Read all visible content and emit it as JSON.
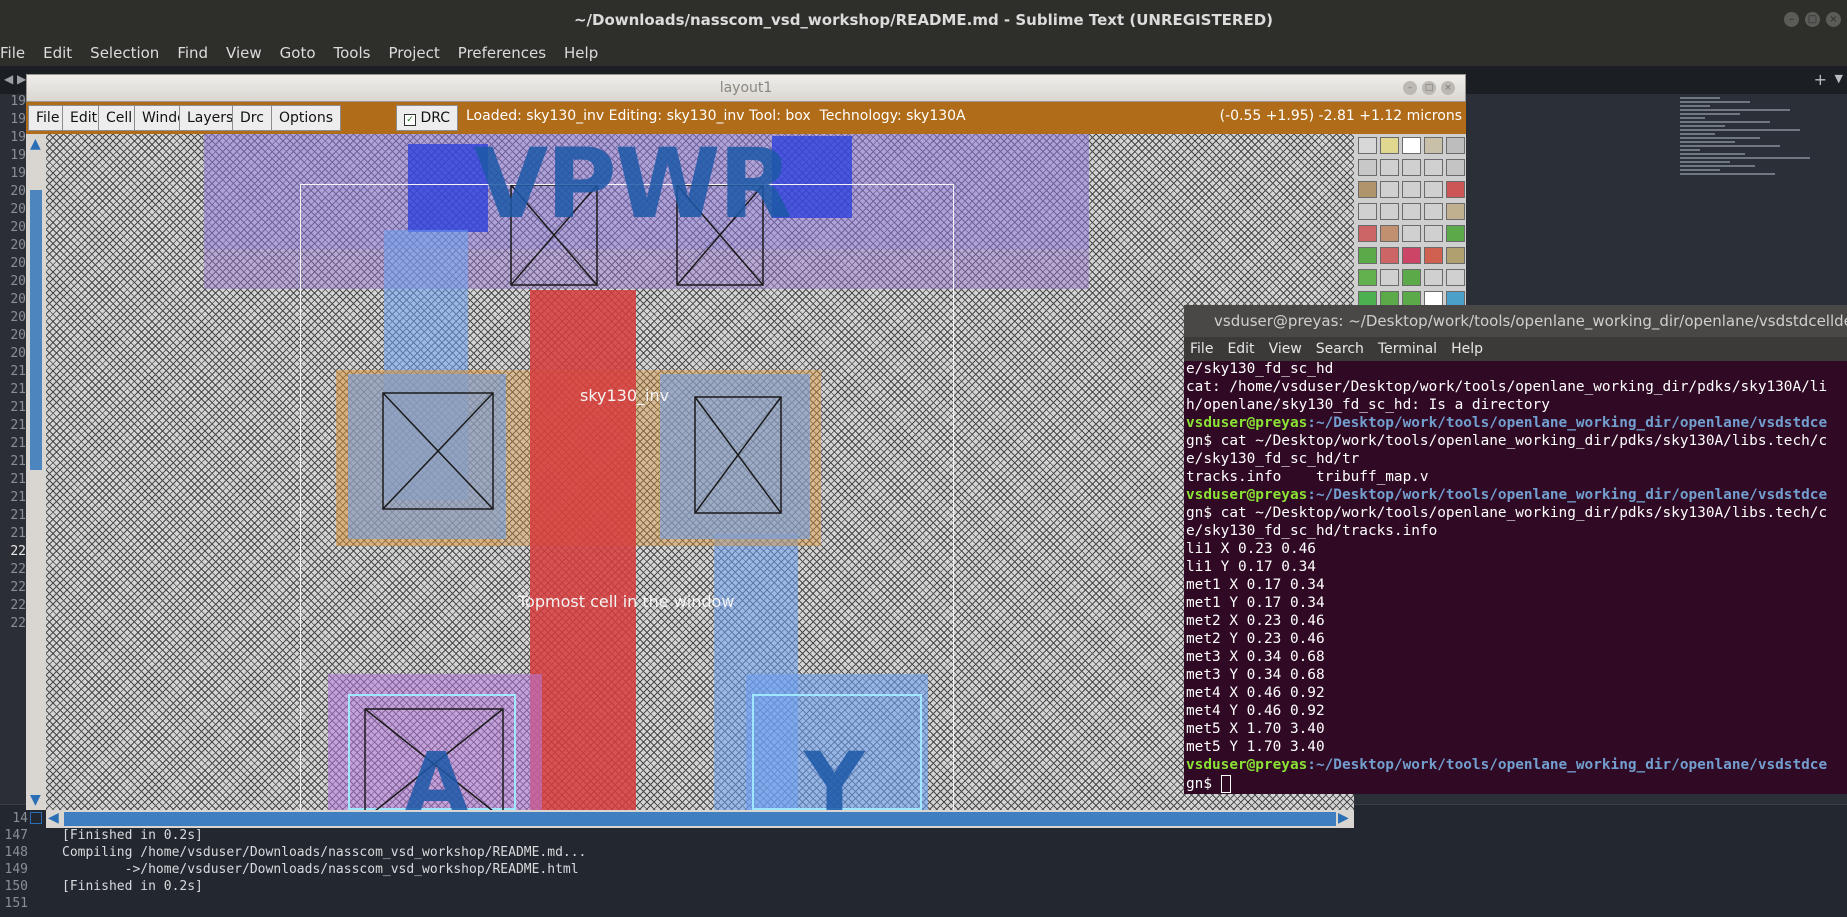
{
  "sublime": {
    "title": "~/Downloads/nasscom_vsd_workshop/README.md - Sublime Text (UNREGISTERED)",
    "menu": [
      "File",
      "Edit",
      "Selection",
      "Find",
      "View",
      "Goto",
      "Tools",
      "Project",
      "Preferences",
      "Help"
    ],
    "gutter_numbers": [
      "19",
      "19",
      "19",
      "19",
      "19",
      "20",
      "20",
      "20",
      "20",
      "20",
      "20",
      "20",
      "20",
      "20",
      "20",
      "21",
      "21",
      "21",
      "21",
      "21",
      "21",
      "21",
      "21",
      "21",
      "21",
      "22",
      "22",
      "22",
      "22",
      "22"
    ],
    "console": [
      {
        "num": "14",
        "text": ""
      },
      {
        "num": "147",
        "text": "[Finished in 0.2s]"
      },
      {
        "num": "148",
        "text": "Compiling /home/vsduser/Downloads/nasscom_vsd_workshop/README.md..."
      },
      {
        "num": "149",
        "text": "        ->/home/vsduser/Downloads/nasscom_vsd_workshop/README.html"
      },
      {
        "num": "150",
        "text": "[Finished in 0.2s]"
      },
      {
        "num": "151",
        "text": ""
      }
    ],
    "plus_icon": "+"
  },
  "magic": {
    "title": "layout1",
    "menu": [
      "File",
      "Edit",
      "Cell",
      "Window",
      "Layers",
      "Drc",
      "Options"
    ],
    "drc_label": "DRC",
    "drc_checked": true,
    "status": "Loaded: sky130_inv Editing: sky130_inv Tool: box  Technology: sky130A",
    "coords": "(-0.55 +1.95) -2.81 +1.12 microns",
    "toolbar_color": "#b06c18",
    "canvas": {
      "vpwr_label": "VPWR",
      "cell_label": "sky130_inv",
      "window_label": "Topmost cell in the window",
      "pin_a": "A",
      "pin_y": "Y"
    }
  },
  "terminal": {
    "title": "vsduser@preyas: ~/Desktop/work/tools/openlane_working_dir/openlane/vsdstdcelldesign",
    "menu": [
      "File",
      "Edit",
      "View",
      "Search",
      "Terminal",
      "Help"
    ],
    "lines": [
      {
        "type": "out",
        "text": "e/sky130_fd_sc_hd"
      },
      {
        "type": "out",
        "text": "cat: /home/vsduser/Desktop/work/tools/openlane_working_dir/pdks/sky130A/li"
      },
      {
        "type": "out",
        "text": "h/openlane/sky130_fd_sc_hd: Is a directory"
      },
      {
        "type": "prompt",
        "user": "vsduser@preyas",
        "path": ":~/Desktop/work/tools/openlane_working_dir/openlane/vsdstdce"
      },
      {
        "type": "out",
        "text": "gn$ cat ~/Desktop/work/tools/openlane_working_dir/pdks/sky130A/libs.tech/c"
      },
      {
        "type": "out",
        "text": "e/sky130_fd_sc_hd/tr"
      },
      {
        "type": "out",
        "text": "tracks.info    tribuff_map.v"
      },
      {
        "type": "prompt",
        "user": "vsduser@preyas",
        "path": ":~/Desktop/work/tools/openlane_working_dir/openlane/vsdstdce"
      },
      {
        "type": "out",
        "text": "gn$ cat ~/Desktop/work/tools/openlane_working_dir/pdks/sky130A/libs.tech/c"
      },
      {
        "type": "out",
        "text": "e/sky130_fd_sc_hd/tracks.info"
      },
      {
        "type": "out",
        "text": "li1 X 0.23 0.46"
      },
      {
        "type": "out",
        "text": "li1 Y 0.17 0.34"
      },
      {
        "type": "out",
        "text": "met1 X 0.17 0.34"
      },
      {
        "type": "out",
        "text": "met1 Y 0.17 0.34"
      },
      {
        "type": "out",
        "text": "met2 X 0.23 0.46"
      },
      {
        "type": "out",
        "text": "met2 Y 0.23 0.46"
      },
      {
        "type": "out",
        "text": "met3 X 0.34 0.68"
      },
      {
        "type": "out",
        "text": "met3 Y 0.34 0.68"
      },
      {
        "type": "out",
        "text": "met4 X 0.46 0.92"
      },
      {
        "type": "out",
        "text": "met4 Y 0.46 0.92"
      },
      {
        "type": "out",
        "text": "met5 X 1.70 3.40"
      },
      {
        "type": "out",
        "text": "met5 Y 1.70 3.40"
      },
      {
        "type": "prompt",
        "user": "vsduser@preyas",
        "path": ":~/Desktop/work/tools/openlane_working_dir/openlane/vsdstdce"
      },
      {
        "type": "cursor",
        "text": "gn$ "
      }
    ]
  }
}
